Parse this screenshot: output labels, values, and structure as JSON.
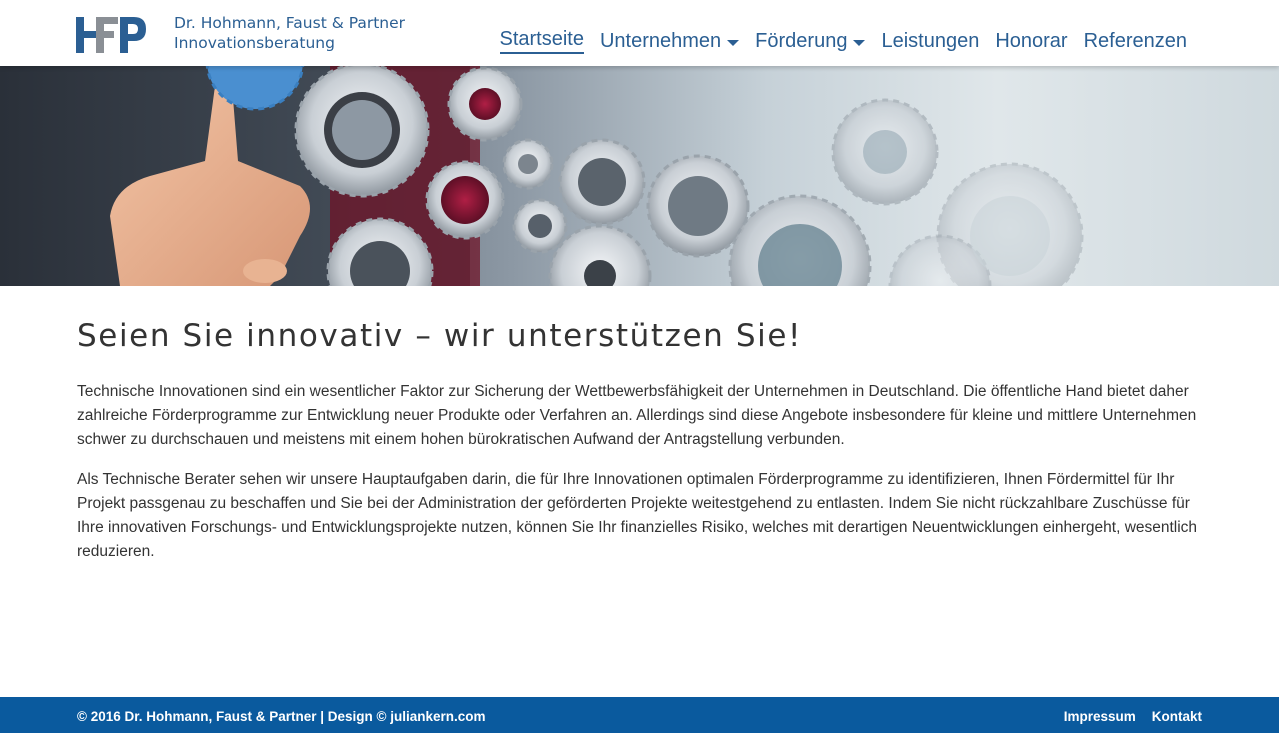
{
  "header": {
    "logo_text_line1": "Dr. Hohmann, Faust & Partner",
    "logo_text_line2": "Innovationsberatung",
    "brand_color": "#2b5f93",
    "logo_accent_color": "#8a8f95"
  },
  "nav": {
    "items": [
      {
        "label": "Startseite",
        "active": true,
        "dropdown": false
      },
      {
        "label": "Unternehmen",
        "active": false,
        "dropdown": true
      },
      {
        "label": "Förderung",
        "active": false,
        "dropdown": true
      },
      {
        "label": "Leistungen",
        "active": false,
        "dropdown": false
      },
      {
        "label": "Honorar",
        "active": false,
        "dropdown": false
      },
      {
        "label": "Referenzen",
        "active": false,
        "dropdown": false
      }
    ]
  },
  "hero": {
    "image": "hand-touching-gears-banner"
  },
  "main": {
    "title": "Seien Sie innovativ – wir unterstützen Sie!",
    "paragraphs": [
      "Technische Innovationen sind ein wesentlicher Faktor zur Sicherung der Wettbewerbsfähigkeit der Unternehmen in Deutschland. Die öffentliche Hand bietet daher zahlreiche Förderprogramme zur Entwicklung neuer Produkte oder Verfahren an. Allerdings sind diese Angebote insbesondere für kleine und mittlere Unternehmen schwer zu durchschauen und meistens mit einem hohen bürokratischen Aufwand der Antragstellung verbunden.",
      "Als Technische Berater sehen wir unsere Hauptaufgaben darin, die für Ihre Innovationen optimalen Förderprogramme zu identifizieren, Ihnen Fördermittel für Ihr Projekt passgenau zu beschaffen und Sie bei der Administration der geförderten Projekte weitestgehend zu entlasten. Indem Sie nicht rückzahlbare Zuschüsse für Ihre innovativen Forschungs- und Entwicklungsprojekte nutzen, können Sie Ihr finanzielles Risiko, welches mit derartigen Neuentwicklungen einhergeht, wesentlich reduzieren."
    ]
  },
  "footer": {
    "copyright": "© 2016 Dr. Hohmann, Faust & Partner | Design © juliankern.com",
    "links": [
      "Impressum",
      "Kontakt"
    ],
    "background_color": "#0a5a9e"
  }
}
